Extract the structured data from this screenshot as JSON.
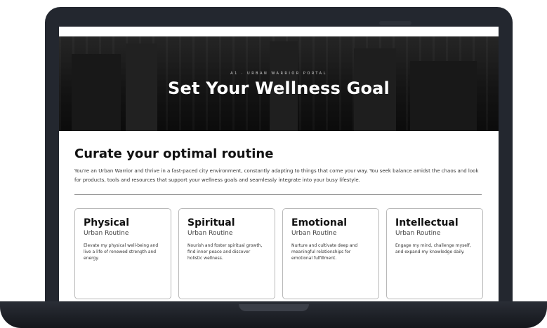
{
  "hero": {
    "eyebrow": "A1 · URBAN WARRIOR PORTAL",
    "title": "Set Your Wellness Goal"
  },
  "intro": {
    "title": "Curate your optimal routine",
    "description": "You're an Urban Warrior and thrive in a fast-paced city environment, constantly adapting to things that come your way. You seek balance amidst the chaos and look for products, tools and resources that support your wellness goals and seamlessly integrate into your busy lifestyle."
  },
  "cards": [
    {
      "title": "Physical",
      "subtitle": "Urban Routine",
      "text": "Elevate my physical well-being and live a life of renewed strength and energy."
    },
    {
      "title": "Spiritual",
      "subtitle": "Urban Routine",
      "text": "Nourish and foster spiritual growth, find inner peace and discover holistic wellness."
    },
    {
      "title": "Emotional",
      "subtitle": "Urban Routine",
      "text": "Nurture and cultivate deep and meaningful relationships for emotional fulfillment."
    },
    {
      "title": "Intellectual",
      "subtitle": "Urban Routine",
      "text": "Engage my mind, challenge myself, and expand my knowledge daily."
    }
  ]
}
